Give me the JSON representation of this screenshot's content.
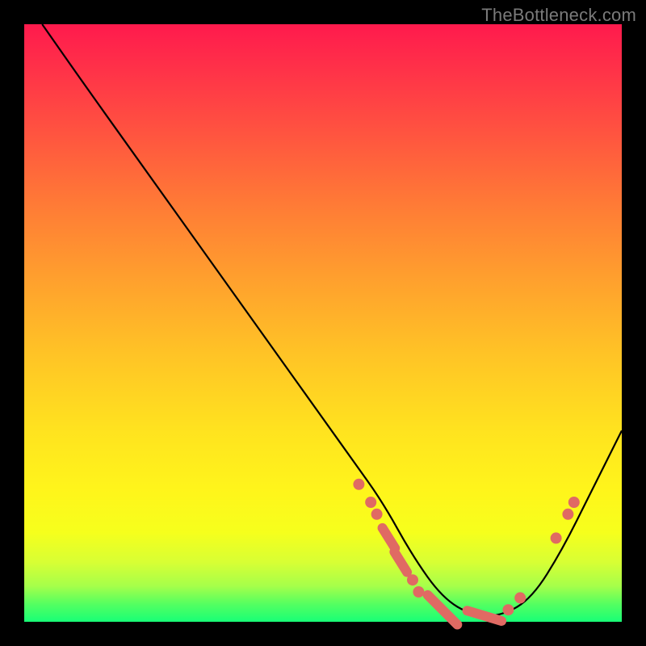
{
  "watermark": "TheBottleneck.com",
  "chart_data": {
    "type": "line",
    "title": "",
    "xlabel": "",
    "ylabel": "",
    "xlim": [
      0,
      100
    ],
    "ylim": [
      0,
      100
    ],
    "grid": false,
    "legend": false,
    "series": [
      {
        "name": "curve",
        "x": [
          3,
          10,
          20,
          30,
          40,
          50,
          55,
          60,
          65,
          70,
          75,
          80,
          85,
          90,
          95,
          100
        ],
        "y": [
          100,
          90,
          76,
          62,
          48,
          34,
          27,
          20,
          11,
          4,
          1,
          1,
          4,
          12,
          22,
          32
        ]
      }
    ],
    "markers": [
      {
        "shape": "dot",
        "x": 56,
        "y": 23
      },
      {
        "shape": "dot",
        "x": 58,
        "y": 20
      },
      {
        "shape": "dot",
        "x": 59,
        "y": 18
      },
      {
        "shape": "dash",
        "x": 61,
        "y": 14,
        "len": 4
      },
      {
        "shape": "dash",
        "x": 63,
        "y": 10,
        "len": 4
      },
      {
        "shape": "dot",
        "x": 65,
        "y": 7
      },
      {
        "shape": "dot",
        "x": 66,
        "y": 5
      },
      {
        "shape": "dash",
        "x": 70,
        "y": 2,
        "len": 7
      },
      {
        "shape": "dash",
        "x": 77,
        "y": 1,
        "len": 6
      },
      {
        "shape": "dot",
        "x": 81,
        "y": 2
      },
      {
        "shape": "dot",
        "x": 83,
        "y": 4
      },
      {
        "shape": "dot",
        "x": 89,
        "y": 14
      },
      {
        "shape": "dot",
        "x": 91,
        "y": 18
      },
      {
        "shape": "dot",
        "x": 92,
        "y": 20
      }
    ]
  }
}
